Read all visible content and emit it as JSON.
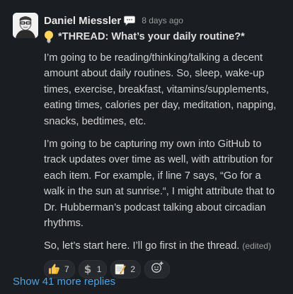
{
  "message": {
    "sender": "Daniel Miessler",
    "timestamp": "8 days ago",
    "title": "*THREAD: What’s your daily routine?*",
    "paragraphs": [
      [
        "I’m going to be reading/thinking/talking a decent",
        "amount about daily routines. So, sleep, wake-up",
        "times, exercise, breakfast, vitamins/supplements,",
        "eating times, calories per day, meditation, napping,",
        "snacks, bedtimes, etc."
      ],
      [
        "I’m going to be capturing my own into GitHub to",
        "track updates over time as well, with attribution for",
        "each item. For example, if line 7 says, “Go for a",
        "walk in the sun at sunrise.“, I might attribute that to",
        "Dr. Hubberman’s podcast talking about circadian",
        "rhythms."
      ]
    ],
    "closing": "So, let’s start here. I’ll go first in the thread.",
    "edited_label": "(edited)"
  },
  "reactions": [
    {
      "icon": "thumbs-up-icon",
      "count": "7"
    },
    {
      "icon": "dollar-icon",
      "count": "1"
    },
    {
      "icon": "memo-icon",
      "count": "2"
    }
  ],
  "thread": {
    "replies_label": "Show 41 more replies"
  },
  "colors": {
    "background": "#1a1d21",
    "link": "#4fa3e0",
    "text": "#d1d2d3"
  }
}
